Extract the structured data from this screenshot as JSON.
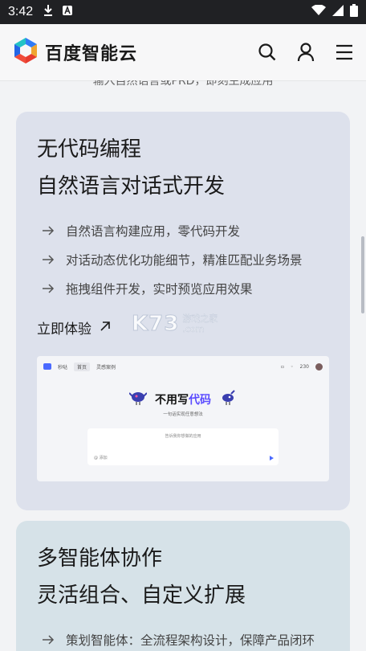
{
  "status_bar": {
    "time": "3:42"
  },
  "header": {
    "brand": "百度智能云"
  },
  "peek_text": "输入自然语言或PRD，即刻生成应用",
  "card1": {
    "title1": "无代码编程",
    "title2": "自然语言对话式开发",
    "features": [
      "自然语言构建应用，零代码开发",
      "对话动态优化功能细节，精准匹配业务场景",
      "拖拽组件开发，实时预览应用效果"
    ],
    "cta": "立即体验",
    "preview": {
      "app_name": "秒哒",
      "tab1": "首页",
      "tab2": "灵感案例",
      "credits": "230",
      "headline_a": "不用写",
      "headline_b": "代码",
      "subline": "一句话实现任意想法",
      "input_placeholder": "告诉我你想做的应用",
      "input_action": "@ 添加"
    }
  },
  "watermark": {
    "main": "K73",
    "line1": "游戏之家",
    "line2": ".com"
  },
  "card2": {
    "title1": "多智能体协作",
    "title2": "灵活组合、自定义扩展",
    "features": [
      "策划智能体：全流程架构设计，保障产品闭环"
    ]
  },
  "colors": {
    "accent": "#5b4cff",
    "card1_bg": "#dde1ec",
    "card2_bg": "#d6e2e8"
  }
}
